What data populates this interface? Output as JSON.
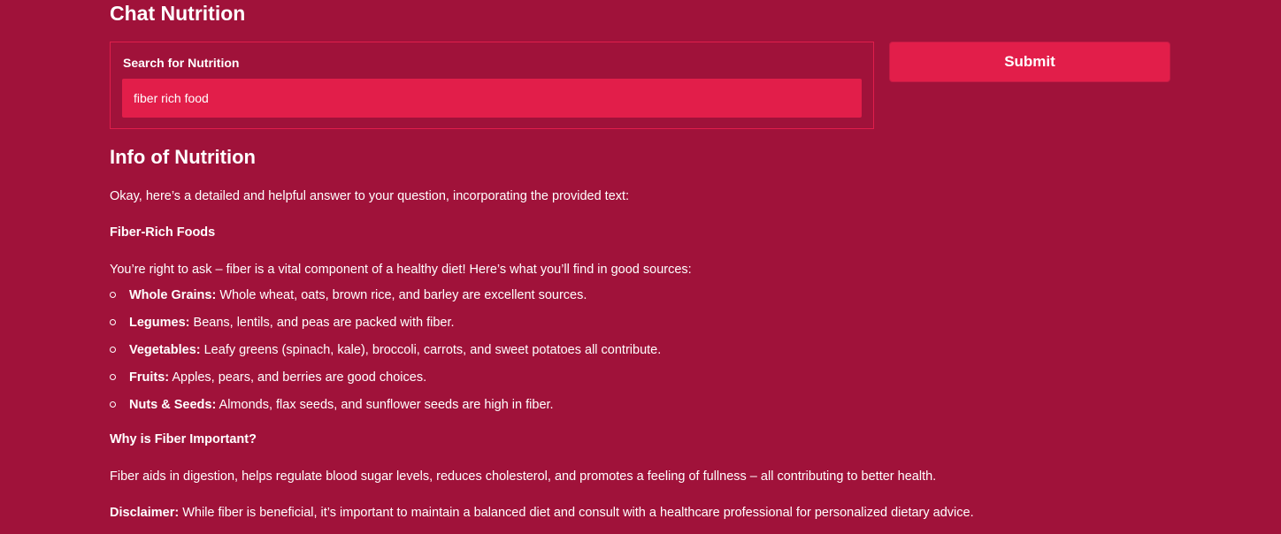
{
  "header": {
    "title": "Chat Nutrition"
  },
  "search": {
    "label": "Search for Nutrition",
    "value": "fiber rich food",
    "submit_label": "Submit"
  },
  "info": {
    "title": "Info of Nutrition",
    "intro": "Okay, here’s a detailed and helpful answer to your question, incorporating the provided text:",
    "subheading_1": "Fiber-Rich Foods",
    "lead": "You’re right to ask – fiber is a vital component of a healthy diet! Here’s what you’ll find in good sources:",
    "items": [
      {
        "term": "Whole Grains:",
        "text": " Whole wheat, oats, brown rice, and barley are excellent sources."
      },
      {
        "term": "Legumes:",
        "text": " Beans, lentils, and peas are packed with fiber."
      },
      {
        "term": "Vegetables:",
        "text": " Leafy greens (spinach, kale), broccoli, carrots, and sweet potatoes all contribute."
      },
      {
        "term": "Fruits:",
        "text": " Apples, pears, and berries are good choices."
      },
      {
        "term": "Nuts & Seeds:",
        "text": " Almonds, flax seeds, and sunflower seeds are high in fiber."
      }
    ],
    "subheading_2": "Why is Fiber Important?",
    "importance": "Fiber aids in digestion, helps regulate blood sugar levels, reduces cholesterol, and promotes a feeling of fullness – all contributing to better health.",
    "disclaimer_label": "Disclaimer:",
    "disclaimer_text": " While fiber is beneficial, it’s important to maintain a balanced diet and consult with a healthcare professional for personalized dietary advice."
  },
  "colors": {
    "background": "#a0123a",
    "accent": "#e21e4a",
    "text": "#ffffff"
  }
}
